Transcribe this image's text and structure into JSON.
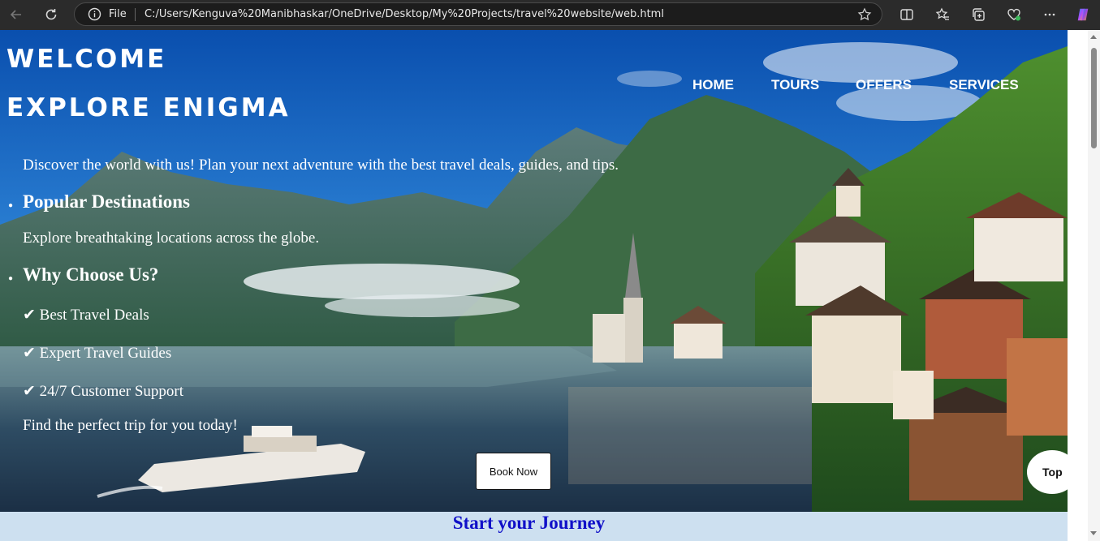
{
  "browser": {
    "file_label": "File",
    "url": "C:/Users/Kenguva%20Manibhaskar/OneDrive/Desktop/My%20Projects/travel%20website/web.html"
  },
  "site": {
    "title_line1": "WELCOME",
    "title_line2": "EXPLORE ENIGMA",
    "nav": [
      "HOME",
      "TOURS",
      "OFFERS",
      "SERVICES"
    ],
    "intro": "Discover the world with us! Plan your next adventure with the best travel deals, guides, and tips.",
    "section1_heading": "Popular Destinations",
    "section1_text": "Explore breathtaking locations across the globe.",
    "section2_heading": "Why Choose Us?",
    "features": [
      "✔ Best Travel Deals",
      "✔ Expert Travel Guides",
      "✔ 24/7 Customer Support"
    ],
    "closing": "Find the perfect trip for you today!",
    "book_button": "Book Now",
    "journey": "Start your Journey",
    "top_button": "Top"
  },
  "icons": [
    "back-icon",
    "refresh-icon",
    "info-icon",
    "favorite-star-icon",
    "split-screen-icon",
    "favorites-icon",
    "collections-icon",
    "browser-essentials-icon",
    "more-icon",
    "copilot-icon"
  ],
  "colors": {
    "journey_text": "#1010c8",
    "journey_bar": "#cde0f0"
  }
}
